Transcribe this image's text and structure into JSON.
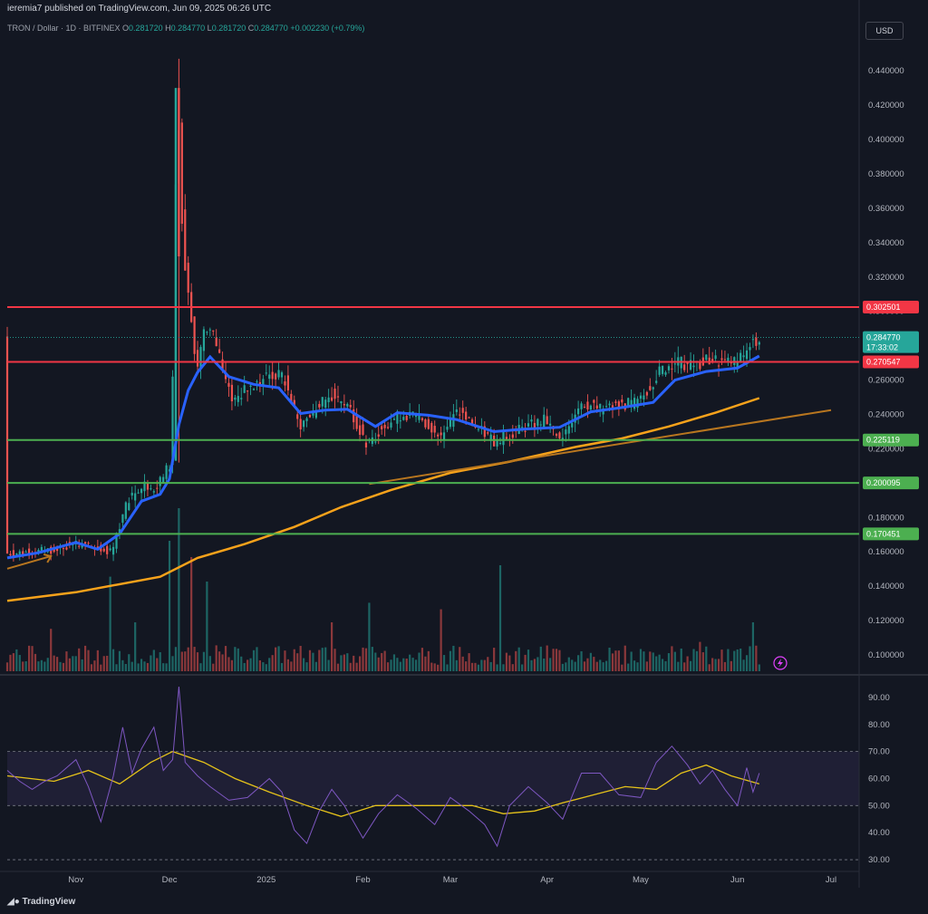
{
  "header": {
    "published": "ieremia7 published on TradingView.com, Jun 09, 2025 06:26 UTC",
    "symbol_prefix": "TRON / Dollar · 1D · BITFINEX",
    "o_label": "O",
    "o_value": "0.281720",
    "h_label": "H",
    "h_value": "0.284770",
    "l_label": "L",
    "l_value": "0.281720",
    "c_label": "C",
    "c_value": "0.284770",
    "change": "+0.002230 (+0.79%)"
  },
  "currency_button": "USD",
  "footer": {
    "brand": "TradingView"
  },
  "colors": {
    "background": "#131722",
    "up": "#26a69a",
    "down": "#ef5350",
    "ema_fast": "#2962ff",
    "ema_slow": "#f7a21b",
    "trendline": "#b8761f",
    "resistance": "#f23645",
    "support": "#4caf50",
    "rsi": "#7e57c2",
    "rsi_ma": "#e5c21a"
  },
  "chart_data": [
    {
      "type": "candlestick",
      "title": "",
      "x_ticks": [
        "Nov",
        "Dec",
        "2025",
        "Feb",
        "Mar",
        "Apr",
        "May",
        "Jun",
        "Jul"
      ],
      "xlim": [
        "2024-10-10",
        "2025-07-10"
      ],
      "ylim": [
        0.09,
        0.458
      ],
      "y_ticks": [
        "0.100000",
        "0.120000",
        "0.140000",
        "0.160000",
        "0.180000",
        "0.200000",
        "0.220000",
        "0.240000",
        "0.260000",
        "0.280000",
        "0.300000",
        "0.320000",
        "0.340000",
        "0.360000",
        "0.380000",
        "0.400000",
        "0.420000",
        "0.440000"
      ],
      "current_price": {
        "label": "0.284770",
        "countdown": "17:33:02",
        "value": 0.28477
      },
      "horizontal_levels": [
        {
          "label": "0.302501",
          "value": 0.302501,
          "role": "resistance"
        },
        {
          "label": "0.270547",
          "value": 0.270547,
          "role": "resistance"
        },
        {
          "label": "0.225119",
          "value": 0.225119,
          "role": "support"
        },
        {
          "label": "0.200095",
          "value": 0.200095,
          "role": "support"
        },
        {
          "label": "0.170451",
          "value": 0.170451,
          "role": "support"
        }
      ],
      "trendline": {
        "start": [
          "2025-02-03",
          0.1995
        ],
        "end": [
          "2025-07-01",
          0.2425
        ]
      },
      "arrow": {
        "start": [
          "2024-10-10",
          0.1502
        ],
        "end": [
          "2024-10-24",
          0.1575
        ]
      },
      "ema_fast": [
        [
          "2024-10-10",
          0.1565
        ],
        [
          "2024-10-20",
          0.1595
        ],
        [
          "2024-11-01",
          0.1655
        ],
        [
          "2024-11-08",
          0.1615
        ],
        [
          "2024-11-15",
          0.1705
        ],
        [
          "2024-11-22",
          0.1895
        ],
        [
          "2024-11-28",
          0.1935
        ],
        [
          "2024-12-01",
          0.2025
        ],
        [
          "2024-12-04",
          0.234
        ],
        [
          "2024-12-07",
          0.254
        ],
        [
          "2024-12-10",
          0.2645
        ],
        [
          "2024-12-14",
          0.2735
        ],
        [
          "2024-12-20",
          0.262
        ],
        [
          "2024-12-28",
          0.2575
        ],
        [
          "2025-01-05",
          0.2555
        ],
        [
          "2025-01-12",
          0.2405
        ],
        [
          "2025-01-20",
          0.2425
        ],
        [
          "2025-01-27",
          0.243
        ],
        [
          "2025-02-05",
          0.233
        ],
        [
          "2025-02-12",
          0.241
        ],
        [
          "2025-02-22",
          0.2395
        ],
        [
          "2025-03-03",
          0.237
        ],
        [
          "2025-03-15",
          0.23
        ],
        [
          "2025-03-25",
          0.2315
        ],
        [
          "2025-04-05",
          0.2325
        ],
        [
          "2025-04-15",
          0.2415
        ],
        [
          "2025-04-25",
          0.244
        ],
        [
          "2025-05-05",
          0.247
        ],
        [
          "2025-05-12",
          0.26
        ],
        [
          "2025-05-22",
          0.265
        ],
        [
          "2025-06-01",
          0.267
        ],
        [
          "2025-06-08",
          0.274
        ]
      ],
      "ema_slow": [
        [
          "2024-10-10",
          0.1315
        ],
        [
          "2024-11-01",
          0.1365
        ],
        [
          "2024-11-28",
          0.1455
        ],
        [
          "2024-12-10",
          0.1565
        ],
        [
          "2024-12-25",
          0.1645
        ],
        [
          "2025-01-10",
          0.1745
        ],
        [
          "2025-01-25",
          0.186
        ],
        [
          "2025-02-10",
          0.196
        ],
        [
          "2025-03-01",
          0.206
        ],
        [
          "2025-03-20",
          0.2125
        ],
        [
          "2025-04-10",
          0.221
        ],
        [
          "2025-04-25",
          0.226
        ],
        [
          "2025-05-10",
          0.233
        ],
        [
          "2025-05-25",
          0.241
        ],
        [
          "2025-06-08",
          0.2495
        ]
      ],
      "price_path": [
        [
          "2024-10-10",
          0.159
        ],
        [
          "2024-10-18",
          0.16
        ],
        [
          "2024-10-25",
          0.161
        ],
        [
          "2024-11-01",
          0.165
        ],
        [
          "2024-11-08",
          0.162
        ],
        [
          "2024-11-13",
          0.16
        ],
        [
          "2024-11-18",
          0.19
        ],
        [
          "2024-11-24",
          0.2
        ],
        [
          "2024-11-27",
          0.195
        ],
        [
          "2024-11-30",
          0.207
        ],
        [
          "2024-12-02",
          0.211
        ],
        [
          "2024-12-04",
          0.43
        ],
        [
          "2024-12-06",
          0.33
        ],
        [
          "2024-12-08",
          0.305
        ],
        [
          "2024-12-10",
          0.263
        ],
        [
          "2024-12-13",
          0.29
        ],
        [
          "2024-12-16",
          0.284
        ],
        [
          "2024-12-19",
          0.265
        ],
        [
          "2024-12-22",
          0.247
        ],
        [
          "2024-12-27",
          0.257
        ],
        [
          "2025-01-02",
          0.263
        ],
        [
          "2025-01-07",
          0.262
        ],
        [
          "2025-01-12",
          0.233
        ],
        [
          "2025-01-16",
          0.24
        ],
        [
          "2025-01-22",
          0.252
        ],
        [
          "2025-01-28",
          0.245
        ],
        [
          "2025-02-03",
          0.221
        ],
        [
          "2025-02-08",
          0.234
        ],
        [
          "2025-02-14",
          0.24
        ],
        [
          "2025-02-20",
          0.238
        ],
        [
          "2025-02-26",
          0.227
        ],
        [
          "2025-03-04",
          0.242
        ],
        [
          "2025-03-10",
          0.232
        ],
        [
          "2025-03-16",
          0.224
        ],
        [
          "2025-03-20",
          0.228
        ],
        [
          "2025-03-25",
          0.232
        ],
        [
          "2025-04-01",
          0.237
        ],
        [
          "2025-04-06",
          0.223
        ],
        [
          "2025-04-12",
          0.248
        ],
        [
          "2025-04-18",
          0.243
        ],
        [
          "2025-04-24",
          0.245
        ],
        [
          "2025-05-01",
          0.247
        ],
        [
          "2025-05-07",
          0.264
        ],
        [
          "2025-05-12",
          0.271
        ],
        [
          "2025-05-18",
          0.268
        ],
        [
          "2025-05-24",
          0.272
        ],
        [
          "2025-05-29",
          0.27
        ],
        [
          "2025-06-02",
          0.271
        ],
        [
          "2025-06-05",
          0.279
        ],
        [
          "2025-06-08",
          0.2848
        ]
      ],
      "volume": [
        [
          "2024-10-24",
          0.26
        ],
        [
          "2024-11-02",
          0.14
        ],
        [
          "2024-11-12",
          0.58
        ],
        [
          "2024-11-20",
          0.3
        ],
        [
          "2024-12-01",
          0.8
        ],
        [
          "2024-12-04",
          1.0
        ],
        [
          "2024-12-08",
          0.7
        ],
        [
          "2024-12-13",
          0.55
        ],
        [
          "2025-01-22",
          0.3
        ],
        [
          "2025-02-03",
          0.42
        ],
        [
          "2025-02-26",
          0.38
        ],
        [
          "2025-03-17",
          0.65
        ],
        [
          "2025-05-20",
          0.18
        ],
        [
          "2025-06-06",
          0.3
        ]
      ]
    },
    {
      "type": "line",
      "title": "",
      "ylim": [
        27,
        96
      ],
      "y_ticks": [
        "30.00",
        "40.00",
        "50.00",
        "60.00",
        "70.00",
        "80.00",
        "90.00"
      ],
      "bands": {
        "upper": 70,
        "middle": 50,
        "lower": 30
      },
      "series": [
        {
          "name": "",
          "points": [
            [
              "2024-10-10",
              63
            ],
            [
              "2024-10-14",
              59
            ],
            [
              "2024-10-18",
              56
            ],
            [
              "2024-10-22",
              59
            ],
            [
              "2024-10-26",
              61
            ],
            [
              "2024-11-01",
              67
            ],
            [
              "2024-11-05",
              57
            ],
            [
              "2024-11-09",
              44
            ],
            [
              "2024-11-13",
              61
            ],
            [
              "2024-11-16",
              79
            ],
            [
              "2024-11-19",
              62
            ],
            [
              "2024-11-22",
              71
            ],
            [
              "2024-11-26",
              79
            ],
            [
              "2024-11-29",
              63
            ],
            [
              "2024-12-02",
              67
            ],
            [
              "2024-12-04",
              94
            ],
            [
              "2024-12-06",
              66
            ],
            [
              "2024-12-10",
              61
            ],
            [
              "2024-12-14",
              57
            ],
            [
              "2024-12-20",
              52
            ],
            [
              "2024-12-26",
              53
            ],
            [
              "2025-01-02",
              60
            ],
            [
              "2025-01-06",
              55
            ],
            [
              "2025-01-10",
              41
            ],
            [
              "2025-01-14",
              36
            ],
            [
              "2025-01-18",
              48
            ],
            [
              "2025-01-22",
              56
            ],
            [
              "2025-01-26",
              50
            ],
            [
              "2025-02-01",
              38
            ],
            [
              "2025-02-06",
              47
            ],
            [
              "2025-02-12",
              54
            ],
            [
              "2025-02-18",
              49
            ],
            [
              "2025-02-24",
              43
            ],
            [
              "2025-03-01",
              53
            ],
            [
              "2025-03-07",
              48
            ],
            [
              "2025-03-12",
              43
            ],
            [
              "2025-03-16",
              35
            ],
            [
              "2025-03-20",
              50
            ],
            [
              "2025-03-26",
              57
            ],
            [
              "2025-04-01",
              51
            ],
            [
              "2025-04-06",
              45
            ],
            [
              "2025-04-12",
              62
            ],
            [
              "2025-04-18",
              62
            ],
            [
              "2025-04-24",
              54
            ],
            [
              "2025-05-01",
              53
            ],
            [
              "2025-05-06",
              66
            ],
            [
              "2025-05-11",
              72
            ],
            [
              "2025-05-16",
              65
            ],
            [
              "2025-05-20",
              58
            ],
            [
              "2025-05-24",
              63
            ],
            [
              "2025-05-28",
              56
            ],
            [
              "2025-06-01",
              50
            ],
            [
              "2025-06-04",
              64
            ],
            [
              "2025-06-06",
              55
            ],
            [
              "2025-06-08",
              62
            ]
          ]
        },
        {
          "name": "",
          "points": [
            [
              "2024-10-10",
              61
            ],
            [
              "2024-10-25",
              59
            ],
            [
              "2024-11-05",
              63
            ],
            [
              "2024-11-15",
              58
            ],
            [
              "2024-11-25",
              66
            ],
            [
              "2024-12-02",
              70
            ],
            [
              "2024-12-12",
              66
            ],
            [
              "2024-12-22",
              60
            ],
            [
              "2025-01-02",
              55
            ],
            [
              "2025-01-14",
              50
            ],
            [
              "2025-01-25",
              46
            ],
            [
              "2025-02-05",
              50
            ],
            [
              "2025-02-15",
              50
            ],
            [
              "2025-02-25",
              50
            ],
            [
              "2025-03-08",
              50
            ],
            [
              "2025-03-18",
              47
            ],
            [
              "2025-03-28",
              48
            ],
            [
              "2025-04-06",
              51
            ],
            [
              "2025-04-16",
              54
            ],
            [
              "2025-04-26",
              57
            ],
            [
              "2025-05-06",
              56
            ],
            [
              "2025-05-14",
              62
            ],
            [
              "2025-05-22",
              65
            ],
            [
              "2025-05-30",
              61
            ],
            [
              "2025-06-08",
              58
            ]
          ]
        }
      ]
    }
  ]
}
